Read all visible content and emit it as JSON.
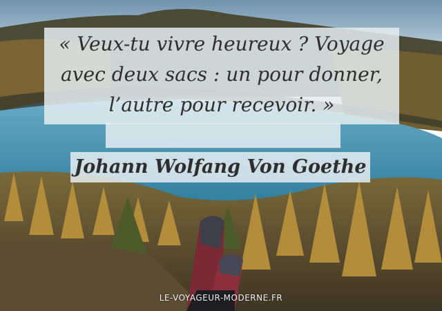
{
  "quote": {
    "line1": "« Veux-tu vivre heureux ? Voyage",
    "line2": "avec deux sacs : un pour donner,",
    "line3": "l’autre pour recevoir. »"
  },
  "author": "Johann Wolfang Von Goethe",
  "watermark": "LE-VOYAGEUR-MODERNE.FR",
  "colors": {
    "sky": "#8fb0c8",
    "lake": "#3f8fae",
    "forest_autumn": "#b08a3a",
    "text": "#2e2e2e",
    "overlay": "#e4ecf0"
  }
}
